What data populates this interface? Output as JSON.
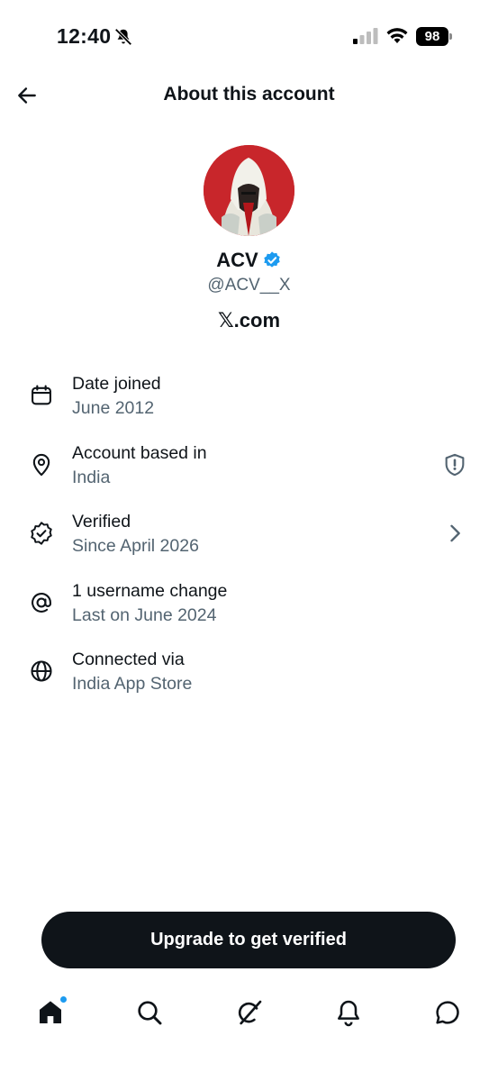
{
  "status_bar": {
    "time": "12:40",
    "battery": "98"
  },
  "header": {
    "title": "About this account"
  },
  "profile": {
    "name": "ACV",
    "handle": "@ACV__X",
    "platform": "𝕏.com"
  },
  "info_rows": [
    {
      "label": "Date joined",
      "value": "June 2012",
      "icon": "calendar-icon"
    },
    {
      "label": "Account based in",
      "value": "India",
      "icon": "location-pin-icon",
      "trailing_icon": "shield-alert-icon"
    },
    {
      "label": "Verified",
      "value": "Since April 2026",
      "icon": "verified-check-icon",
      "trailing_icon": "chevron-right-icon"
    },
    {
      "label": "1 username change",
      "value": "Last on June 2024",
      "icon": "at-sign-icon"
    },
    {
      "label": "Connected via",
      "value": "India App Store",
      "icon": "globe-icon"
    }
  ],
  "cta": {
    "label": "Upgrade to get verified"
  },
  "tabs": [
    "home-icon",
    "search-icon",
    "grok-icon",
    "bell-icon",
    "messages-icon"
  ],
  "colors": {
    "accent": "#1d9bf0",
    "text": "#0f1419",
    "secondary": "#536471",
    "avatar_bg": "#c8262b"
  }
}
